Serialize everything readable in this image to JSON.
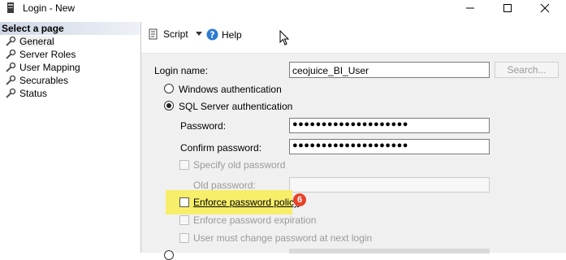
{
  "window": {
    "title": "Login - New",
    "icon": "database-login-icon",
    "minimize_icon": "minimize-icon",
    "maximize_icon": "maximize-icon",
    "close_icon": "close-icon"
  },
  "left_pane": {
    "header": "Select a page",
    "items": [
      {
        "label": "General",
        "icon": "wrench-icon",
        "selected": true
      },
      {
        "label": "Server Roles",
        "icon": "wrench-icon",
        "selected": false
      },
      {
        "label": "User Mapping",
        "icon": "wrench-icon",
        "selected": false
      },
      {
        "label": "Securables",
        "icon": "wrench-icon",
        "selected": false
      },
      {
        "label": "Status",
        "icon": "wrench-icon",
        "selected": false
      }
    ]
  },
  "toolbar": {
    "script_label": "Script",
    "help_label": "Help"
  },
  "form": {
    "login_name_label": "Login name:",
    "login_name_value": "ceojuice_BI_User",
    "search_label": "Search...",
    "windows_auth_label": "Windows authentication",
    "sql_auth_label": "SQL Server authentication",
    "password_label": "Password:",
    "password_value": "●●●●●●●●●●●●●●●●●●●●",
    "confirm_password_label": "Confirm password:",
    "confirm_password_value": "●●●●●●●●●●●●●●●●●●●●",
    "specify_old_password_label": "Specify old password",
    "old_password_label": "Old password:",
    "enforce_policy_label": "Enforce password policy",
    "enforce_expiration_label": "Enforce password expiration",
    "must_change_label": "User must change password at next login",
    "callout_number": "6"
  },
  "colors": {
    "highlight": "#f7ee6a",
    "callout": "#e8412a",
    "help_icon": "#2b7bd2"
  }
}
